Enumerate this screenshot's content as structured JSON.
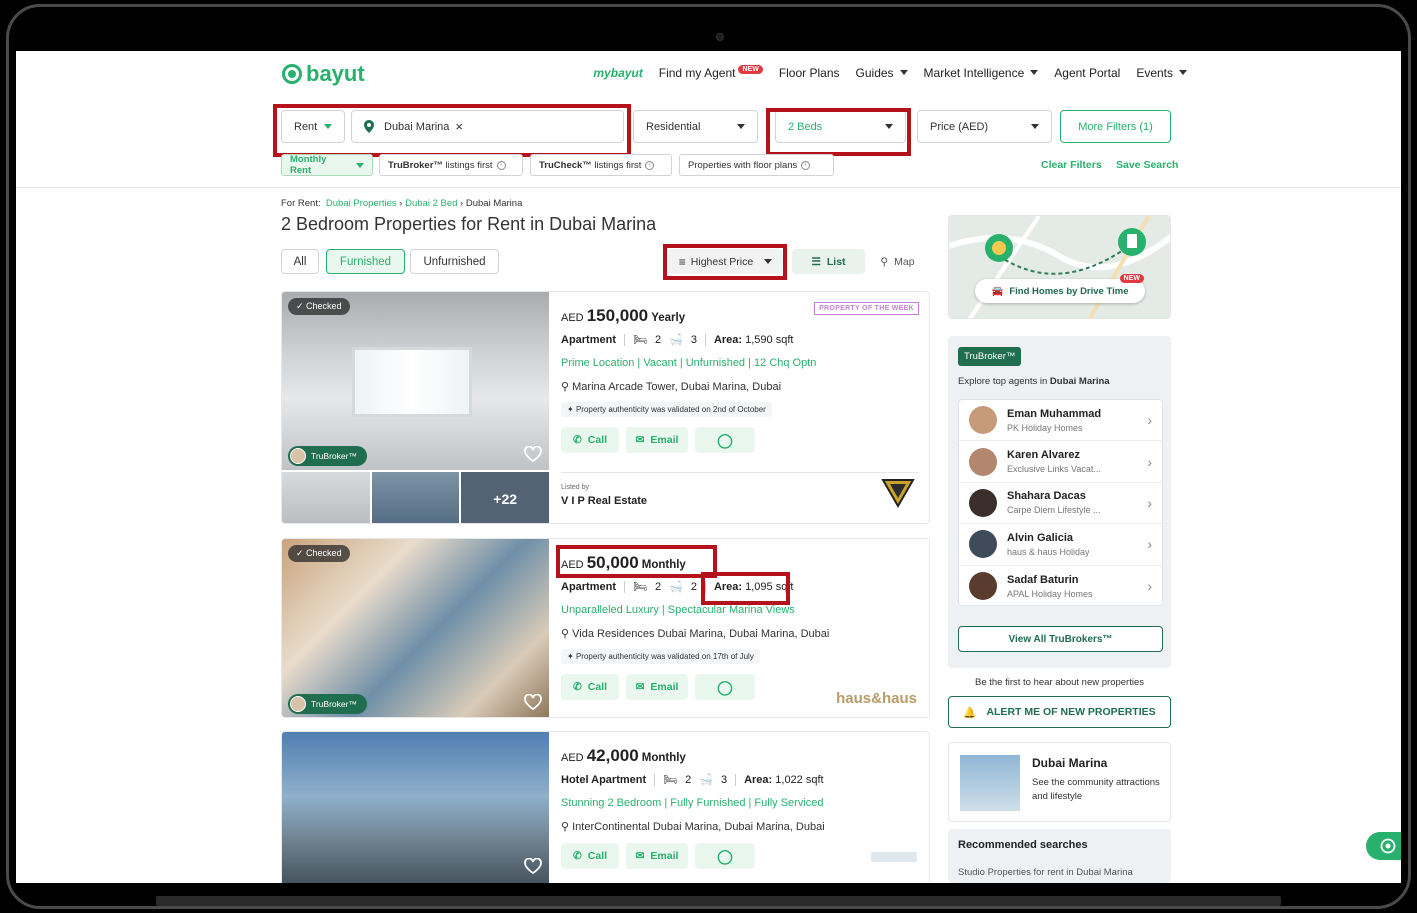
{
  "header": {
    "logo": "bayut",
    "mybayut": "mybayut",
    "nav": [
      {
        "label": "Find my Agent",
        "badge": "NEW"
      },
      {
        "label": "Floor Plans"
      },
      {
        "label": "Guides",
        "dropdown": true
      },
      {
        "label": "Market Intelligence",
        "dropdown": true
      },
      {
        "label": "Agent Portal"
      },
      {
        "label": "Events",
        "dropdown": true
      }
    ]
  },
  "search": {
    "purpose": "Rent",
    "location": "Dubai Marina",
    "type": "Residential",
    "beds": "2 Beds",
    "price": "Price (AED)",
    "more_filters": "More Filters",
    "more_filters_count": "(1)"
  },
  "chips": {
    "monthly": "Monthly Rent",
    "trubroker_prefix": "TruBroker™",
    "trubroker_suffix": "listings first",
    "trucheck_prefix": "TruCheck™",
    "trucheck_suffix": "listings first",
    "floorplans": "Properties with floor plans",
    "clear": "Clear Filters",
    "save": "Save Search"
  },
  "breadcrumb": {
    "prefix": "For Rent:",
    "items": [
      "Dubai Properties",
      "Dubai 2 Bed",
      "Dubai Marina"
    ]
  },
  "page_title": "2 Bedroom Properties for Rent in Dubai Marina",
  "furnishing": [
    "All",
    "Furnished",
    "Unfurnished"
  ],
  "sort": "Highest Price",
  "view": {
    "list": "List",
    "map": "Map"
  },
  "listings": [
    {
      "checked": "Checked",
      "currency": "AED",
      "price": "150,000",
      "period": "Yearly",
      "type": "Apartment",
      "beds": "2",
      "baths": "3",
      "area_label": "Area:",
      "area": "1,590 sqft",
      "headline": "Prime Location | Vacant | Unfurnished | 12 Chq Optn",
      "location": "Marina Arcade Tower, Dubai Marina, Dubai",
      "authenticity": "Property authenticity was validated on 2nd of October",
      "badge": "PROPERTY OF THE WEEK",
      "trubroker": "TruBroker™",
      "more_photos": "+22",
      "listed_by": "Listed by",
      "agency": "V I P Real Estate"
    },
    {
      "checked": "Checked",
      "currency": "AED",
      "price": "50,000",
      "period": "Monthly",
      "type": "Apartment",
      "beds": "2",
      "baths": "2",
      "area_label": "Area:",
      "area": "1,095 sqft",
      "headline": "Unparalleled Luxury | Spectacular Marina Views",
      "location": "Vida Residences Dubai Marina, Dubai Marina, Dubai",
      "authenticity": "Property authenticity was validated on 17th of July",
      "trubroker": "TruBroker™",
      "agency_logo": "haus&haus"
    },
    {
      "currency": "AED",
      "price": "42,000",
      "period": "Monthly",
      "type": "Hotel Apartment",
      "beds": "2",
      "baths": "3",
      "area_label": "Area:",
      "area": "1,022 sqft",
      "headline": "Stunning 2 Bedroom | Fully Furnished | Fully Serviced",
      "location": "InterContinental Dubai Marina, Dubai Marina, Dubai"
    }
  ],
  "actions": {
    "call": "Call",
    "email": "Email"
  },
  "sidebar": {
    "drive_time": "Find Homes by Drive Time",
    "drive_badge": "NEW",
    "trubroker_label": "TruBroker™",
    "explore_prefix": "Explore top agents in",
    "explore_place": "Dubai Marina",
    "agents": [
      {
        "name": "Eman Muhammad",
        "company": "PK Holiday Homes"
      },
      {
        "name": "Karen Alvarez",
        "company": "Exclusive Links Vacat..."
      },
      {
        "name": "Shahara Dacas",
        "company": "Carpe Diem Lifestyle ..."
      },
      {
        "name": "Alvin Galicia",
        "company": "haus & haus Holiday"
      },
      {
        "name": "Sadaf Baturin",
        "company": "APAL Holiday Homes"
      }
    ],
    "view_all": "View All TruBrokers™",
    "hear_first": "Be the first to hear about new properties",
    "alert": "ALERT ME OF NEW PROPERTIES",
    "community_title": "Dubai Marina",
    "community_desc": "See the community attractions and lifestyle",
    "recommended_title": "Recommended searches",
    "recommended_item": "Studio Properties for rent in Dubai Marina"
  },
  "colors": {
    "brand": "#28b16d",
    "dark_green": "#1f6e4f",
    "highlight": "#b5121b"
  }
}
